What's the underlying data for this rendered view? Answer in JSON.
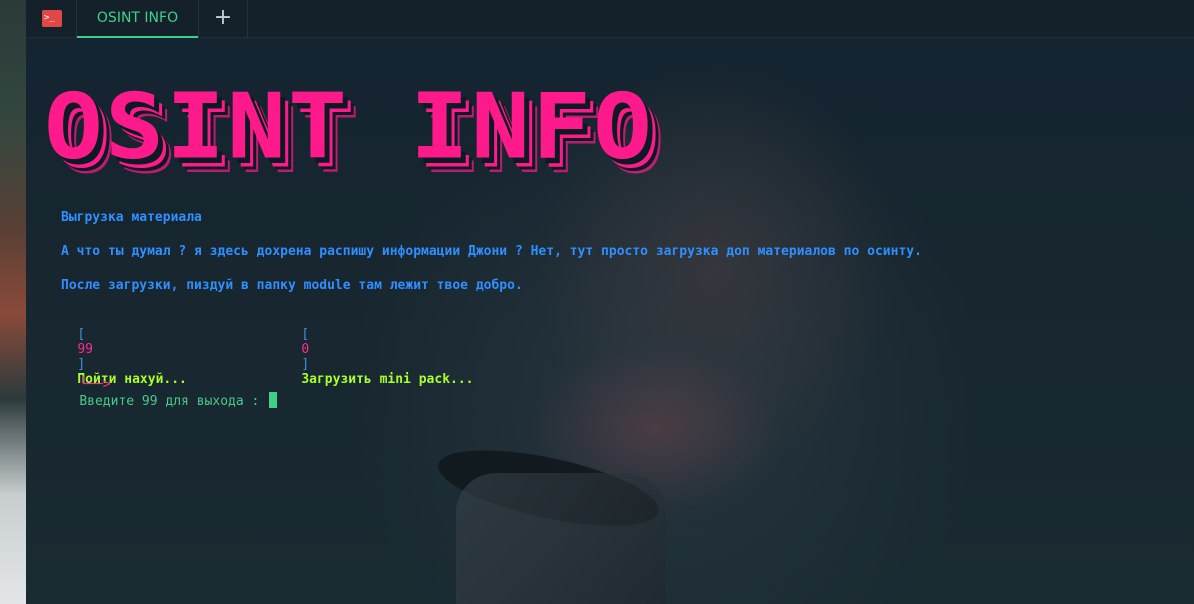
{
  "tabbar": {
    "app_icon_glyph": ">_",
    "tab_title": "OSINT INFO",
    "new_tab_glyph": "+"
  },
  "terminal": {
    "banner": "OSINT INFO",
    "lines": [
      "Выгрузка материала",
      "А что ты думал ? я здесь дохрена распишу информации Джони ? Нет, тут просто загрузка доп материалов по осинту.",
      "После загрузки, пиздуй в папку module там лежит твое добро."
    ],
    "options": [
      {
        "open": "[",
        "number": "99",
        "close": "]",
        "label": "Пойти нахуй..."
      },
      {
        "open": "[",
        "number": "0",
        "close": "]",
        "label": "Загрузить mini pack..."
      }
    ],
    "prompt_arrow": "└──>",
    "prompt_text": "Введите 99 для выхода :"
  },
  "colors": {
    "accent_green": "#3fd08a",
    "banner_pink": "#ff1a8c",
    "text_blue": "#2f8fff",
    "option_green": "#a8ff2d"
  }
}
